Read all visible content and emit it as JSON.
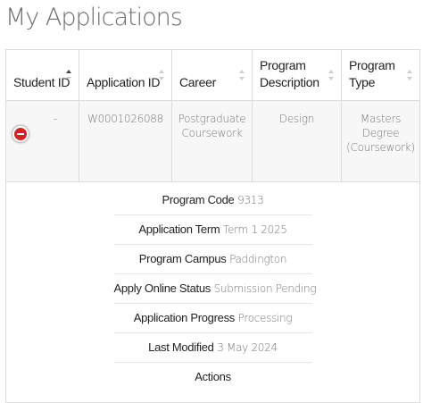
{
  "page": {
    "title": "My Applications"
  },
  "table": {
    "columns": [
      {
        "label": "Student ID",
        "sort": "ascending"
      },
      {
        "label": "Application ID",
        "sort": "none"
      },
      {
        "label": "Career",
        "sort": "none"
      },
      {
        "label": "Program Description",
        "sort": "none"
      },
      {
        "label": "Program Type",
        "sort": "none"
      }
    ],
    "rows": [
      {
        "student_id": "-",
        "application_id": "W0001026088",
        "career": "Postgraduate Coursework",
        "program_description": "Design",
        "program_type": "Masters Degree (Coursework)"
      }
    ],
    "collapse_icon": "minus-circle-icon",
    "collapse_color": "#d9201f"
  },
  "details": {
    "program_code": {
      "label": "Program Code",
      "value": "9313"
    },
    "application_term": {
      "label": "Application Term",
      "value": "Term 1 2025"
    },
    "program_campus": {
      "label": "Program Campus",
      "value": "Paddington"
    },
    "apply_online_status": {
      "label": "Apply Online Status",
      "value": "Submission Pending"
    },
    "application_progress": {
      "label": "Application Progress",
      "value": "Processing"
    },
    "last_modified": {
      "label": "Last Modified",
      "value": "3 May 2024"
    },
    "actions": {
      "label": "Actions"
    }
  }
}
